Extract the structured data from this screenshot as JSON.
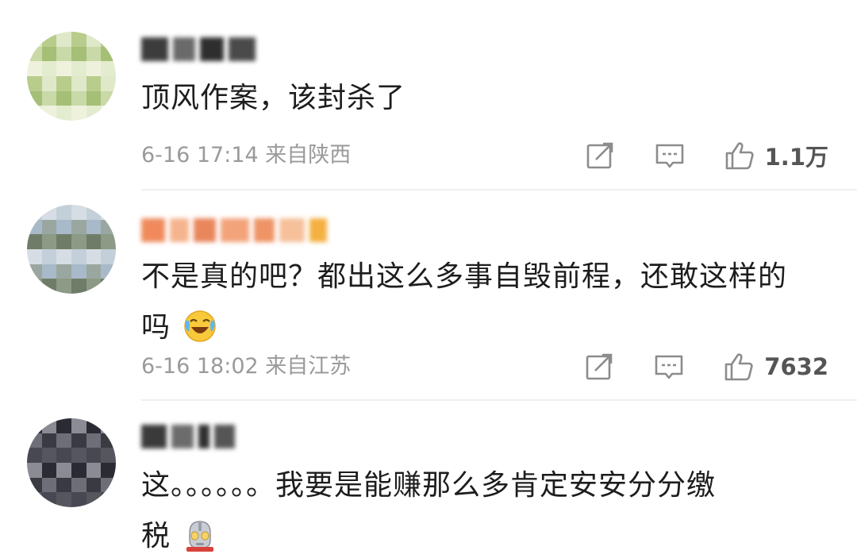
{
  "comments": [
    {
      "text": "顶风作案，该封杀了",
      "time": "6-16 17:14",
      "location": "来自陕西",
      "likes": "1.1万",
      "username_blurred": true,
      "avatar_palette": [
        "#dfe8c8",
        "#c9d9a8",
        "#eef2dc",
        "#b8cc8c",
        "#a5bf76",
        "#e4ecd0"
      ]
    },
    {
      "text_line1": "不是真的吧？都出这么多事自毁前程，还敢这样的",
      "text_line2": "吗",
      "emoji": "laugh-cry-emoji",
      "time": "6-16 18:02",
      "location": "来自江苏",
      "likes": "7632",
      "username_blurred": true,
      "avatar_palette": [
        "#8c9a86",
        "#c3cfd9",
        "#a8b9c9",
        "#6f7d68",
        "#d6dde4",
        "#9aa7a0"
      ]
    },
    {
      "text_line1": "这。。。。。。我要是能赚那么多肯定安安分分缴",
      "text_line2": "税",
      "emoji": "ultraman-emoji",
      "username_blurred": true,
      "avatar_palette": [
        "#3a3a42",
        "#55565e",
        "#2a2b33",
        "#6d6e77",
        "#474852",
        "#8a8b94"
      ]
    }
  ],
  "colors": {
    "meta_gray": "#9a9a9a",
    "icon_gray": "#8c8c8c",
    "divider": "#efefef"
  }
}
